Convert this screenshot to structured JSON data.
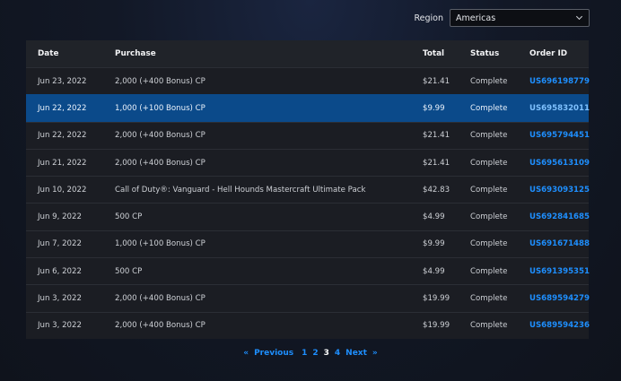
{
  "region": {
    "label": "Region",
    "selected": "Americas"
  },
  "table": {
    "headers": {
      "date": "Date",
      "purchase": "Purchase",
      "total": "Total",
      "status": "Status",
      "order_id": "Order ID"
    },
    "rows": [
      {
        "date": "Jun 23, 2022",
        "purchase": "2,000 (+400 Bonus) CP",
        "total": "$21.41",
        "status": "Complete",
        "order_id": "US696198779"
      },
      {
        "date": "Jun 22, 2022",
        "purchase": "1,000 (+100 Bonus) CP",
        "total": "$9.99",
        "status": "Complete",
        "order_id": "US695832011"
      },
      {
        "date": "Jun 22, 2022",
        "purchase": "2,000 (+400 Bonus) CP",
        "total": "$21.41",
        "status": "Complete",
        "order_id": "US695794451"
      },
      {
        "date": "Jun 21, 2022",
        "purchase": "2,000 (+400 Bonus) CP",
        "total": "$21.41",
        "status": "Complete",
        "order_id": "US695613109"
      },
      {
        "date": "Jun 10, 2022",
        "purchase": "Call of Duty®: Vanguard - Hell Hounds Mastercraft Ultimate Pack",
        "total": "$42.83",
        "status": "Complete",
        "order_id": "US693093125"
      },
      {
        "date": "Jun 9, 2022",
        "purchase": "500 CP",
        "total": "$4.99",
        "status": "Complete",
        "order_id": "US692841685"
      },
      {
        "date": "Jun 7, 2022",
        "purchase": "1,000 (+100 Bonus) CP",
        "total": "$9.99",
        "status": "Complete",
        "order_id": "US691671488"
      },
      {
        "date": "Jun 6, 2022",
        "purchase": "500 CP",
        "total": "$4.99",
        "status": "Complete",
        "order_id": "US691395351"
      },
      {
        "date": "Jun 3, 2022",
        "purchase": "2,000 (+400 Bonus) CP",
        "total": "$19.99",
        "status": "Complete",
        "order_id": "US689594279"
      },
      {
        "date": "Jun 3, 2022",
        "purchase": "2,000 (+400 Bonus) CP",
        "total": "$19.99",
        "status": "Complete",
        "order_id": "US689594236"
      }
    ]
  },
  "pagination": {
    "first": "«",
    "previous": "Previous",
    "pages": [
      "1",
      "2",
      "3",
      "4"
    ],
    "current": "3",
    "next": "Next",
    "last": "»"
  },
  "colors": {
    "link": "#1e8fff",
    "selected_row": "#0b4a8a"
  }
}
